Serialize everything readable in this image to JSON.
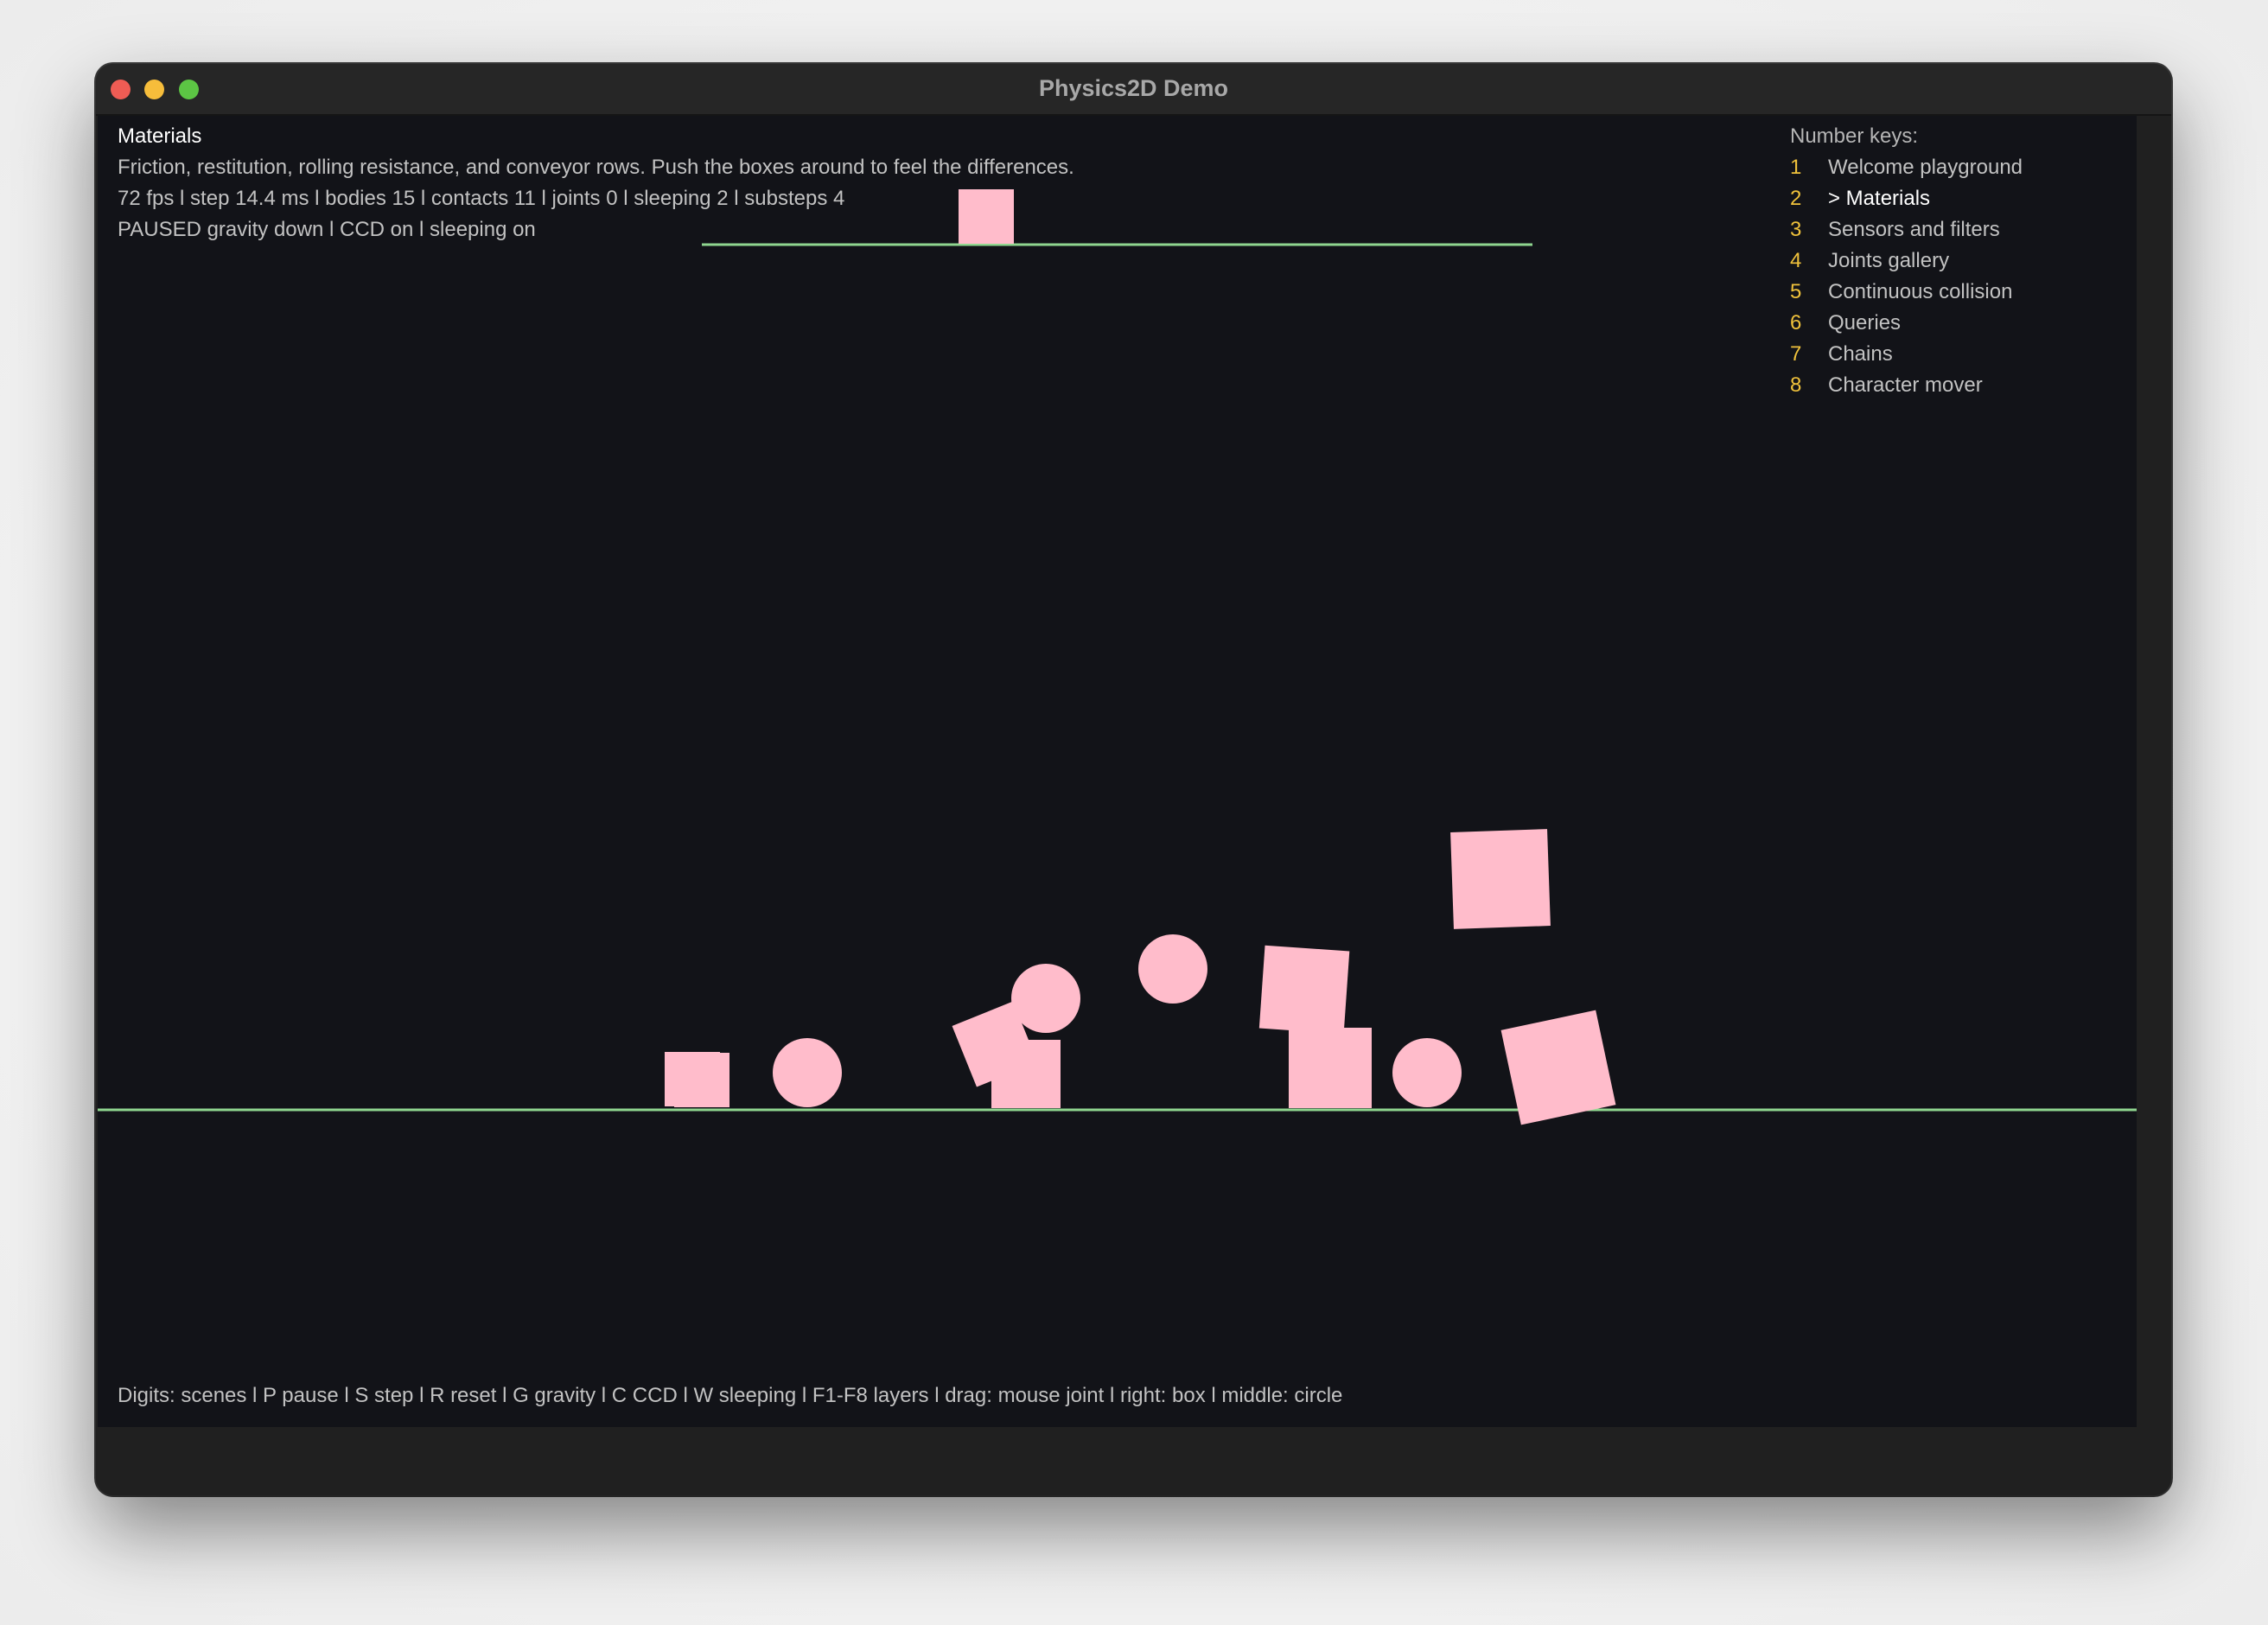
{
  "window": {
    "title": "Physics2D Demo"
  },
  "hud": {
    "scene_title": "Materials",
    "description": "Friction, restitution, rolling resistance, and conveyor rows. Push the boxes around to feel the differences.",
    "stats": "72 fps l step 14.4 ms l bodies 15 l contacts 11 l joints 0 l sleeping 2 l substeps 4",
    "status": "PAUSED gravity down l CCD on l sleeping on"
  },
  "scene_menu": {
    "header": "Number keys:",
    "items": [
      {
        "key": "1",
        "label": "Welcome playground",
        "active": false
      },
      {
        "key": "2",
        "label": "> Materials",
        "active": true
      },
      {
        "key": "3",
        "label": "Sensors and filters",
        "active": false
      },
      {
        "key": "4",
        "label": "Joints gallery",
        "active": false
      },
      {
        "key": "5",
        "label": "Continuous collision",
        "active": false
      },
      {
        "key": "6",
        "label": "Queries",
        "active": false
      },
      {
        "key": "7",
        "label": "Chains",
        "active": false
      },
      {
        "key": "8",
        "label": "Character mover",
        "active": false
      }
    ]
  },
  "footer": {
    "help": "Digits: scenes l P pause l S step l R reset l G gravity l C CCD l W sleeping l F1-F8 layers l drag: mouse joint l right: box l middle: circle"
  },
  "colors": {
    "background": "#121318",
    "body_fill": "#ffbccb",
    "static_line": "#8fd68f",
    "key_number": "#f0c23b"
  }
}
